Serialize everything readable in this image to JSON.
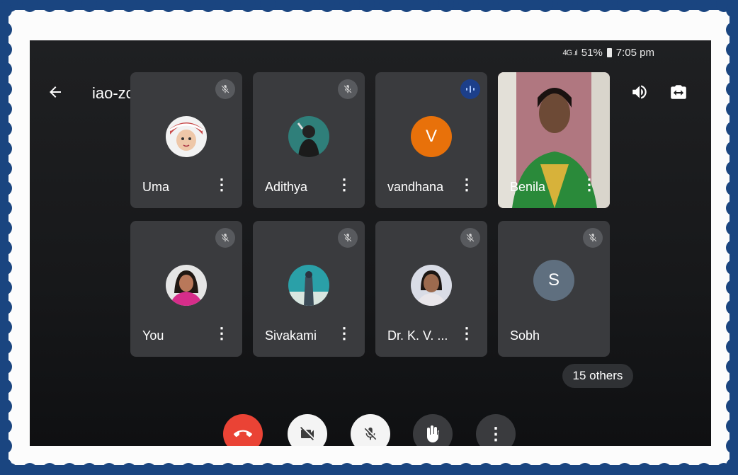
{
  "status_bar": {
    "signal": "4G .ıl",
    "battery": "51%",
    "time": "7:05 pm"
  },
  "meeting": {
    "code": "iao-zchq-iqj"
  },
  "participants": [
    {
      "name": "Uma",
      "muted": true
    },
    {
      "name": "Adithya",
      "muted": true
    },
    {
      "name": "vandhana",
      "initial": "V",
      "speaking": true,
      "color": "#e8710a"
    },
    {
      "name": "Benila",
      "video": true
    },
    {
      "name": "You",
      "muted": true
    },
    {
      "name": "Sivakami",
      "muted": true
    },
    {
      "name": "Dr. K. V. ...",
      "muted": true
    },
    {
      "name": "Sobh",
      "initial": "S",
      "muted": true,
      "color": "#5f6f7f"
    }
  ],
  "others_chip": "15 others",
  "controls": {
    "end_call_color": "#ea4335"
  },
  "icons": {
    "back": "arrow-left-icon",
    "speaker": "speaker-icon",
    "flip": "switch-camera-icon",
    "mic_off": "mic-off-icon",
    "video_off": "video-off-icon",
    "hand": "raise-hand-icon",
    "more": "more-vert-icon"
  }
}
